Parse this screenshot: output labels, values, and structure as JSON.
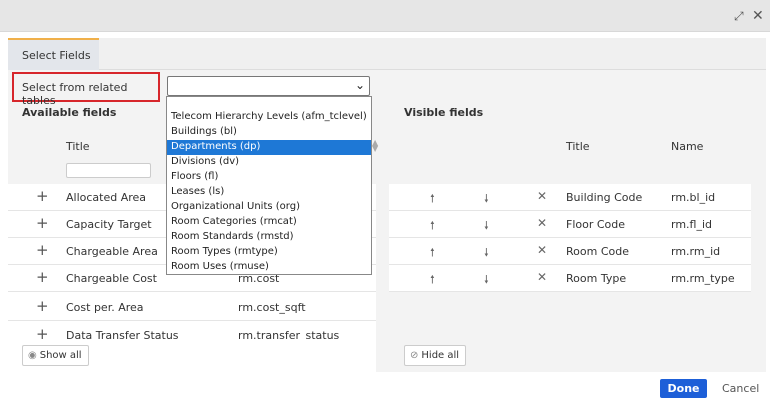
{
  "window": {
    "maximize_icon": "expand-arrows-icon",
    "close_icon": "close-x-icon"
  },
  "tabs": [
    {
      "label": "Select Fields",
      "active": true
    }
  ],
  "related": {
    "label": "Select from related tables",
    "selected_value": "",
    "options": [
      "Telecom Hierarchy Levels (afm_tclevel)",
      "Buildings (bl)",
      "Departments (dp)",
      "Divisions (dv)",
      "Floors (fl)",
      "Leases (ls)",
      "Organizational Units (org)",
      "Room Categories (rmcat)",
      "Room Standards (rmstd)",
      "Room Types (rmtype)",
      "Room Uses (rmuse)"
    ],
    "highlighted_option": "Departments (dp)"
  },
  "available": {
    "heading": "Available fields",
    "col_title": "Title",
    "filter_placeholder": "",
    "rows": [
      {
        "title": "Allocated Area",
        "name": ""
      },
      {
        "title": "Capacity Target",
        "name": ""
      },
      {
        "title": "Chargeable Area",
        "name": ""
      },
      {
        "title": "Chargeable Cost",
        "name": "rm.cost"
      },
      {
        "title": "Cost per. Area",
        "name": "rm.cost_sqft"
      },
      {
        "title": "Data Transfer Status",
        "name": "rm.transfer_status"
      }
    ],
    "show_all_label": "Show all"
  },
  "visible": {
    "heading": "Visible fields",
    "col_title": "Title",
    "col_name": "Name",
    "rows": [
      {
        "title": "Building Code",
        "name": "rm.bl_id"
      },
      {
        "title": "Floor Code",
        "name": "rm.fl_id"
      },
      {
        "title": "Room Code",
        "name": "rm.rm_id"
      },
      {
        "title": "Room Type",
        "name": "rm.rm_type"
      }
    ],
    "hide_all_label": "Hide all"
  },
  "footer": {
    "done_label": "Done",
    "cancel_label": "Cancel"
  },
  "colors": {
    "primary_button": "#1d5fd8",
    "highlight": "#d7262b",
    "selected_option": "#1e78d6",
    "tab_accent": "#f0b04a"
  }
}
